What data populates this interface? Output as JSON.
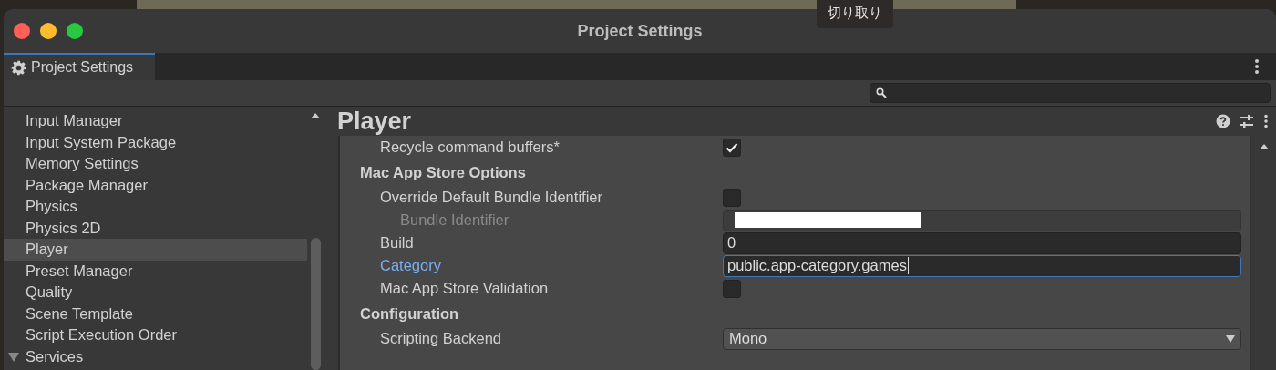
{
  "tooltip": "切り取り",
  "window": {
    "title": "Project Settings"
  },
  "tabs": [
    {
      "label": "Project Settings",
      "selected": true
    }
  ],
  "sidebar": {
    "items": [
      {
        "label": "Input Manager",
        "selected": false
      },
      {
        "label": "Input System Package",
        "selected": false
      },
      {
        "label": "Memory Settings",
        "selected": false
      },
      {
        "label": "Package Manager",
        "selected": false
      },
      {
        "label": "Physics",
        "selected": false
      },
      {
        "label": "Physics 2D",
        "selected": false
      },
      {
        "label": "Player",
        "selected": true
      },
      {
        "label": "Preset Manager",
        "selected": false
      },
      {
        "label": "Quality",
        "selected": false
      },
      {
        "label": "Scene Template",
        "selected": false
      },
      {
        "label": "Script Execution Order",
        "selected": false
      },
      {
        "label": "Services",
        "selected": false,
        "expanded": true
      }
    ]
  },
  "panel": {
    "title": "Player",
    "rows": [
      {
        "kind": "checkbox",
        "label": "Recycle command buffers*",
        "checked": true
      },
      {
        "kind": "section",
        "label": "Mac App Store Options"
      },
      {
        "kind": "checkbox",
        "label": "Override Default Bundle Identifier",
        "checked": false,
        "children": [
          {
            "kind": "text",
            "label": "Bundle Identifier",
            "disabled": true,
            "redacted": true
          }
        ]
      },
      {
        "kind": "text",
        "label": "Build",
        "value": "0",
        "focused": false
      },
      {
        "kind": "text",
        "label": "Category",
        "value": "public.app-category.games",
        "focused": true
      },
      {
        "kind": "checkbox",
        "label": "Mac App Store Validation",
        "checked": false
      },
      {
        "kind": "section",
        "label": "Configuration"
      },
      {
        "kind": "dropdown",
        "label": "Scripting Backend",
        "value": "Mono"
      }
    ]
  }
}
